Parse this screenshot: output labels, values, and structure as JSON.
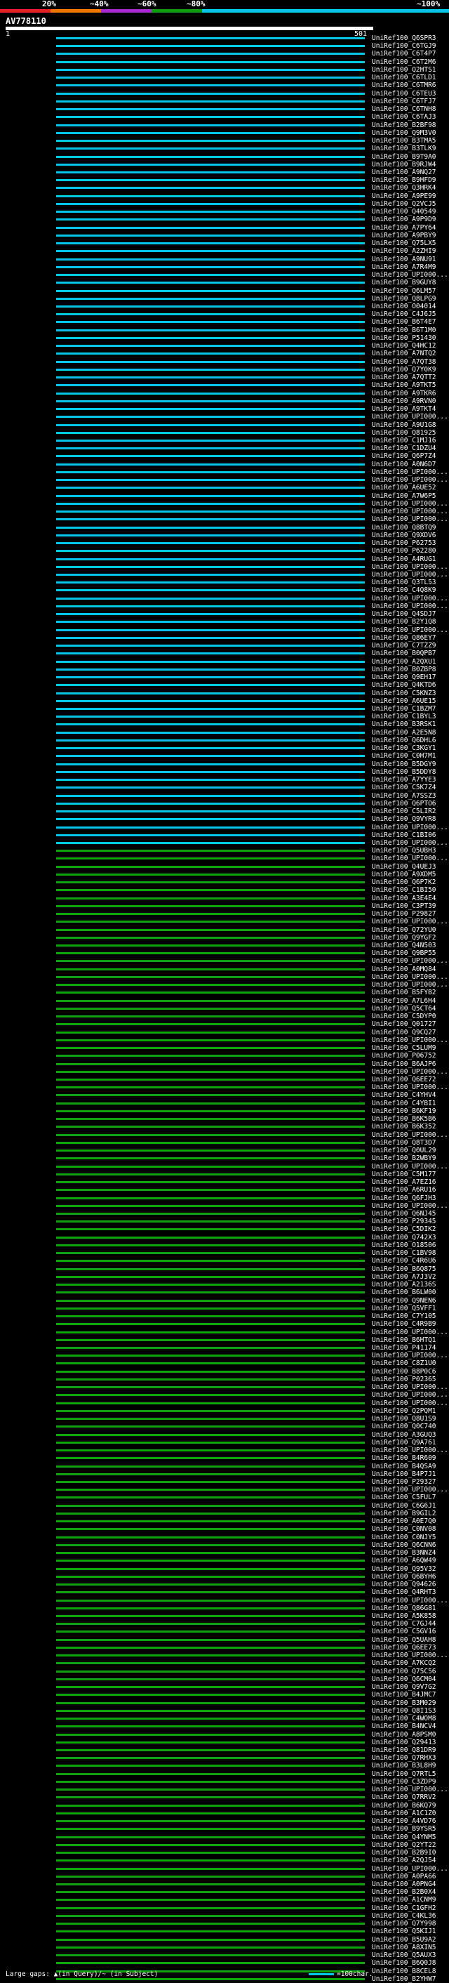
{
  "header": {
    "percent_labels": [
      "20%",
      "~40%",
      "~60%",
      "~80%",
      "~100%"
    ],
    "colors": [
      "#e8202a",
      "#f07800",
      "#a82ad2",
      "#109b10",
      "#00c8e6"
    ]
  },
  "query": {
    "id": "AV778110"
  },
  "ruler": {
    "start": "1",
    "end": "501"
  },
  "hit_colors": {
    "cyan": "#00c8e6",
    "green": "#10a310"
  },
  "hits": [
    {
      "id": "UniRef100_Q6SPR3",
      "color": "cyan"
    },
    {
      "id": "UniRef100_C6TGJ9",
      "color": "cyan"
    },
    {
      "id": "UniRef100_C6T4P7",
      "color": "cyan"
    },
    {
      "id": "UniRef100_C6T2M6",
      "color": "cyan"
    },
    {
      "id": "UniRef100_Q2HTS1",
      "color": "cyan"
    },
    {
      "id": "UniRef100_C6TLD1",
      "color": "cyan"
    },
    {
      "id": "UniRef100_C6TMR6",
      "color": "cyan"
    },
    {
      "id": "UniRef100_C6TEU3",
      "color": "cyan"
    },
    {
      "id": "UniRef100_C6TFJ7",
      "color": "cyan"
    },
    {
      "id": "UniRef100_C6TNH8",
      "color": "cyan"
    },
    {
      "id": "UniRef100_C6TAJ3",
      "color": "cyan"
    },
    {
      "id": "UniRef100_B2BF98",
      "color": "cyan"
    },
    {
      "id": "UniRef100_Q9M3V0",
      "color": "cyan"
    },
    {
      "id": "UniRef100_B3TMA5",
      "color": "cyan"
    },
    {
      "id": "UniRef100_B3TLK9",
      "color": "cyan"
    },
    {
      "id": "UniRef100_B9T9A0",
      "color": "cyan"
    },
    {
      "id": "UniRef100_B9RJW4",
      "color": "cyan"
    },
    {
      "id": "UniRef100_A9NQ27",
      "color": "cyan"
    },
    {
      "id": "UniRef100_B9HFD9",
      "color": "cyan"
    },
    {
      "id": "UniRef100_Q3HRK4",
      "color": "cyan"
    },
    {
      "id": "UniRef100_A9PE99",
      "color": "cyan"
    },
    {
      "id": "UniRef100_Q2VCJ5",
      "color": "cyan"
    },
    {
      "id": "UniRef100_Q40549",
      "color": "cyan"
    },
    {
      "id": "UniRef100_A9P9D9",
      "color": "cyan"
    },
    {
      "id": "UniRef100_A7PY64",
      "color": "cyan"
    },
    {
      "id": "UniRef100_A9PBY9",
      "color": "cyan"
    },
    {
      "id": "UniRef100_Q75LX5",
      "color": "cyan"
    },
    {
      "id": "UniRef100_A2ZHI9",
      "color": "cyan"
    },
    {
      "id": "UniRef100_A9NU91",
      "color": "cyan"
    },
    {
      "id": "UniRef100_A7R4M9",
      "color": "cyan"
    },
    {
      "id": "UniRef100_UPI000...",
      "color": "cyan"
    },
    {
      "id": "UniRef100_B9GUY8",
      "color": "cyan"
    },
    {
      "id": "UniRef100_Q6LM57",
      "color": "cyan"
    },
    {
      "id": "UniRef100_Q8LPG9",
      "color": "cyan"
    },
    {
      "id": "UniRef100_O04014",
      "color": "cyan"
    },
    {
      "id": "UniRef100_C4J6J5",
      "color": "cyan"
    },
    {
      "id": "UniRef100_B6T4E7",
      "color": "cyan"
    },
    {
      "id": "UniRef100_B6T1M0",
      "color": "cyan"
    },
    {
      "id": "UniRef100_P51430",
      "color": "cyan"
    },
    {
      "id": "UniRef100_Q4HC12",
      "color": "cyan"
    },
    {
      "id": "UniRef100_A7NTQ2",
      "color": "cyan"
    },
    {
      "id": "UniRef100_A7QT38",
      "color": "cyan"
    },
    {
      "id": "UniRef100_Q7Y0K9",
      "color": "cyan"
    },
    {
      "id": "UniRef100_A7QTT2",
      "color": "cyan"
    },
    {
      "id": "UniRef100_A9TKT5",
      "color": "cyan"
    },
    {
      "id": "UniRef100_A9TKR6",
      "color": "cyan"
    },
    {
      "id": "UniRef100_A9RVN0",
      "color": "cyan"
    },
    {
      "id": "UniRef100_A9TKT4",
      "color": "cyan"
    },
    {
      "id": "UniRef100_UPI000...",
      "color": "cyan"
    },
    {
      "id": "UniRef100_A9U1G8",
      "color": "cyan"
    },
    {
      "id": "UniRef100_Q81925",
      "color": "cyan"
    },
    {
      "id": "UniRef100_C1MJ16",
      "color": "cyan"
    },
    {
      "id": "UniRef100_C1DZU4",
      "color": "cyan"
    },
    {
      "id": "UniRef100_Q6P7Z4",
      "color": "cyan"
    },
    {
      "id": "UniRef100_A0N6D7",
      "color": "cyan"
    },
    {
      "id": "UniRef100_UPI000...",
      "color": "cyan"
    },
    {
      "id": "UniRef100_UPI000...",
      "color": "cyan"
    },
    {
      "id": "UniRef100_A6UE52",
      "color": "cyan"
    },
    {
      "id": "UniRef100_A7W6P5",
      "color": "cyan"
    },
    {
      "id": "UniRef100_UPI000...",
      "color": "cyan"
    },
    {
      "id": "UniRef100_UPI000...",
      "color": "cyan"
    },
    {
      "id": "UniRef100_UPI000...",
      "color": "cyan"
    },
    {
      "id": "UniRef100_Q8BTQ9",
      "color": "cyan"
    },
    {
      "id": "UniRef100_Q9XDV6",
      "color": "cyan"
    },
    {
      "id": "UniRef100_P62753",
      "color": "cyan"
    },
    {
      "id": "UniRef100_P62280",
      "color": "cyan"
    },
    {
      "id": "UniRef100_A4RUG1",
      "color": "cyan"
    },
    {
      "id": "UniRef100_UPI000...",
      "color": "cyan"
    },
    {
      "id": "UniRef100_UPI000...",
      "color": "cyan"
    },
    {
      "id": "UniRef100_Q3TL53",
      "color": "cyan"
    },
    {
      "id": "UniRef100_C4Q8K9",
      "color": "cyan"
    },
    {
      "id": "UniRef100_UPI000...",
      "color": "cyan"
    },
    {
      "id": "UniRef100_UPI000...",
      "color": "cyan"
    },
    {
      "id": "UniRef100_Q4SDJ7",
      "color": "cyan"
    },
    {
      "id": "UniRef100_B2Y1Q8",
      "color": "cyan"
    },
    {
      "id": "UniRef100_UPI000...",
      "color": "cyan"
    },
    {
      "id": "UniRef100_Q86EY7",
      "color": "cyan"
    },
    {
      "id": "UniRef100_C7TZZ9",
      "color": "cyan"
    },
    {
      "id": "UniRef100_B0QPB7",
      "color": "cyan"
    },
    {
      "id": "UniRef100_A2QXU1",
      "color": "cyan"
    },
    {
      "id": "UniRef100_B0ZBP8",
      "color": "cyan"
    },
    {
      "id": "UniRef100_Q9EH17",
      "color": "cyan"
    },
    {
      "id": "UniRef100_Q4KTD6",
      "color": "cyan"
    },
    {
      "id": "UniRef100_C5KNZ3",
      "color": "cyan"
    },
    {
      "id": "UniRef100_A6UE15",
      "color": "cyan"
    },
    {
      "id": "UniRef100_C1BZM7",
      "color": "cyan"
    },
    {
      "id": "UniRef100_C1BYL3",
      "color": "cyan"
    },
    {
      "id": "UniRef100_B3RSK1",
      "color": "cyan"
    },
    {
      "id": "UniRef100_A2E5N8",
      "color": "cyan"
    },
    {
      "id": "UniRef100_Q6DHL6",
      "color": "cyan"
    },
    {
      "id": "UniRef100_C3KGY1",
      "color": "cyan"
    },
    {
      "id": "UniRef100_C0H7M1",
      "color": "cyan"
    },
    {
      "id": "UniRef100_B5DGY9",
      "color": "cyan"
    },
    {
      "id": "UniRef100_B5DDY8",
      "color": "cyan"
    },
    {
      "id": "UniRef100_A7YYE3",
      "color": "cyan"
    },
    {
      "id": "UniRef100_C5K7Z4",
      "color": "cyan"
    },
    {
      "id": "UniRef100_A7SSZ3",
      "color": "cyan"
    },
    {
      "id": "UniRef100_Q6PTO6",
      "color": "cyan"
    },
    {
      "id": "UniRef100_C5LIR2",
      "color": "cyan"
    },
    {
      "id": "UniRef100_Q9VYR8",
      "color": "cyan"
    },
    {
      "id": "UniRef100_UPI000...",
      "color": "cyan"
    },
    {
      "id": "UniRef100_C1BI06",
      "color": "cyan"
    },
    {
      "id": "UniRef100_UPI000...",
      "color": "cyan"
    },
    {
      "id": "UniRef100_Q5UBH3",
      "color": "green"
    },
    {
      "id": "UniRef100_UPI000...",
      "color": "green"
    },
    {
      "id": "UniRef100_Q4UEJ3",
      "color": "green"
    },
    {
      "id": "UniRef100_A9XDM5",
      "color": "green"
    },
    {
      "id": "UniRef100_Q6P7K2",
      "color": "green"
    },
    {
      "id": "UniRef100_C1BI50",
      "color": "green"
    },
    {
      "id": "UniRef100_A3E4E4",
      "color": "green"
    },
    {
      "id": "UniRef100_C3PT39",
      "color": "green"
    },
    {
      "id": "UniRef100_P29827",
      "color": "green"
    },
    {
      "id": "UniRef100_UPI000...",
      "color": "green"
    },
    {
      "id": "UniRef100_Q72YU0",
      "color": "green"
    },
    {
      "id": "UniRef100_Q9YGF2",
      "color": "green"
    },
    {
      "id": "UniRef100_Q4N503",
      "color": "green"
    },
    {
      "id": "UniRef100_Q9BP55",
      "color": "green"
    },
    {
      "id": "UniRef100_UPI000...",
      "color": "green"
    },
    {
      "id": "UniRef100_A0MQ84",
      "color": "green"
    },
    {
      "id": "UniRef100_UPI000...",
      "color": "green"
    },
    {
      "id": "UniRef100_UPI000...",
      "color": "green"
    },
    {
      "id": "UniRef100_B5FYB2",
      "color": "green"
    },
    {
      "id": "UniRef100_A7L6H4",
      "color": "green"
    },
    {
      "id": "UniRef100_Q5CT64",
      "color": "green"
    },
    {
      "id": "UniRef100_C5DYP0",
      "color": "green"
    },
    {
      "id": "UniRef100_Q01727",
      "color": "green"
    },
    {
      "id": "UniRef100_Q9CQ27",
      "color": "green"
    },
    {
      "id": "UniRef100_UPI000...",
      "color": "green"
    },
    {
      "id": "UniRef100_C5LUM9",
      "color": "green"
    },
    {
      "id": "UniRef100_P06752",
      "color": "green"
    },
    {
      "id": "UniRef100_B6AJP6",
      "color": "green"
    },
    {
      "id": "UniRef100_UPI000...",
      "color": "green"
    },
    {
      "id": "UniRef100_Q6EE72",
      "color": "green"
    },
    {
      "id": "UniRef100_UPI000...",
      "color": "green"
    },
    {
      "id": "UniRef100_C4YHV4",
      "color": "green"
    },
    {
      "id": "UniRef100_C4YBI1",
      "color": "green"
    },
    {
      "id": "UniRef100_B6KF19",
      "color": "green"
    },
    {
      "id": "UniRef100_B6K5B6",
      "color": "green"
    },
    {
      "id": "UniRef100_B6K352",
      "color": "green"
    },
    {
      "id": "UniRef100_UPI000...",
      "color": "green"
    },
    {
      "id": "UniRef100_Q8T3D7",
      "color": "green"
    },
    {
      "id": "UniRef100_Q0UL29",
      "color": "green"
    },
    {
      "id": "UniRef100_B2WBY9",
      "color": "green"
    },
    {
      "id": "UniRef100_UPI000...",
      "color": "green"
    },
    {
      "id": "UniRef100_C5M177",
      "color": "green"
    },
    {
      "id": "UniRef100_A7EZ16",
      "color": "green"
    },
    {
      "id": "UniRef100_A6RU16",
      "color": "green"
    },
    {
      "id": "UniRef100_Q6FJH3",
      "color": "green"
    },
    {
      "id": "UniRef100_UPI000...",
      "color": "green"
    },
    {
      "id": "UniRef100_Q6NJ45",
      "color": "green"
    },
    {
      "id": "UniRef100_P29345",
      "color": "green"
    },
    {
      "id": "UniRef100_C5DIK2",
      "color": "green"
    },
    {
      "id": "UniRef100_Q742X3",
      "color": "green"
    },
    {
      "id": "UniRef100_O18506",
      "color": "green"
    },
    {
      "id": "UniRef100_C1BV98",
      "color": "green"
    },
    {
      "id": "UniRef100_C4R6U6",
      "color": "green"
    },
    {
      "id": "UniRef100_B6Q875",
      "color": "green"
    },
    {
      "id": "UniRef100_A7J3V2",
      "color": "green"
    },
    {
      "id": "UniRef100_A2136S",
      "color": "green"
    },
    {
      "id": "UniRef100_B6LW00",
      "color": "green"
    },
    {
      "id": "UniRef100_Q9NEN6",
      "color": "green"
    },
    {
      "id": "UniRef100_Q5VFF1",
      "color": "green"
    },
    {
      "id": "UniRef100_C7Y105",
      "color": "green"
    },
    {
      "id": "UniRef100_C4R9B9",
      "color": "green"
    },
    {
      "id": "UniRef100_UPI000...",
      "color": "green"
    },
    {
      "id": "UniRef100_B6HTQ1",
      "color": "green"
    },
    {
      "id": "UniRef100_P41174",
      "color": "green"
    },
    {
      "id": "UniRef100_UPI000...",
      "color": "green"
    },
    {
      "id": "UniRef100_C8Z1U0",
      "color": "green"
    },
    {
      "id": "UniRef100_B8P0C6",
      "color": "green"
    },
    {
      "id": "UniRef100_P02365",
      "color": "green"
    },
    {
      "id": "UniRef100_UPI000...",
      "color": "green"
    },
    {
      "id": "UniRef100_UPI000...",
      "color": "green"
    },
    {
      "id": "UniRef100_UPI000...",
      "color": "green"
    },
    {
      "id": "UniRef100_Q2PQM1",
      "color": "green"
    },
    {
      "id": "UniRef100_Q8U1S9",
      "color": "green"
    },
    {
      "id": "UniRef100_Q0C740",
      "color": "green"
    },
    {
      "id": "UniRef100_A3GUQ3",
      "color": "green"
    },
    {
      "id": "UniRef100_Q9A761",
      "color": "green"
    },
    {
      "id": "UniRef100_UPI000...",
      "color": "green"
    },
    {
      "id": "UniRef100_B4R609",
      "color": "green"
    },
    {
      "id": "UniRef100_B4QSA9",
      "color": "green"
    },
    {
      "id": "UniRef100_B4P7J1",
      "color": "green"
    },
    {
      "id": "UniRef100_P29327",
      "color": "green"
    },
    {
      "id": "UniRef100_UPI000...",
      "color": "green"
    },
    {
      "id": "UniRef100_C5FUL7",
      "color": "green"
    },
    {
      "id": "UniRef100_C6G6J1",
      "color": "green"
    },
    {
      "id": "UniRef100_B9GIL2",
      "color": "green"
    },
    {
      "id": "UniRef100_A0E7Q0",
      "color": "green"
    },
    {
      "id": "UniRef100_C0NV08",
      "color": "green"
    },
    {
      "id": "UniRef100_C0NJY5",
      "color": "green"
    },
    {
      "id": "UniRef100_Q6CNN6",
      "color": "green"
    },
    {
      "id": "UniRef100_B3NNZ4",
      "color": "green"
    },
    {
      "id": "UniRef100_A6QW49",
      "color": "green"
    },
    {
      "id": "UniRef100_Q95V32",
      "color": "green"
    },
    {
      "id": "UniRef100_Q6BYH6",
      "color": "green"
    },
    {
      "id": "UniRef100_Q94626",
      "color": "green"
    },
    {
      "id": "UniRef100_Q4RHT3",
      "color": "green"
    },
    {
      "id": "UniRef100_UPI000...",
      "color": "green"
    },
    {
      "id": "UniRef100_Q86G81",
      "color": "green"
    },
    {
      "id": "UniRef100_A5K858",
      "color": "green"
    },
    {
      "id": "UniRef100_C7GJ44",
      "color": "green"
    },
    {
      "id": "UniRef100_C5GV16",
      "color": "green"
    },
    {
      "id": "UniRef100_Q5UAH8",
      "color": "green"
    },
    {
      "id": "UniRef100_Q6EE73",
      "color": "green"
    },
    {
      "id": "UniRef100_UPI000...",
      "color": "green"
    },
    {
      "id": "UniRef100_A7KCQ2",
      "color": "green"
    },
    {
      "id": "UniRef100_Q75C56",
      "color": "green"
    },
    {
      "id": "UniRef100_Q6CM04",
      "color": "green"
    },
    {
      "id": "UniRef100_Q9V7G2",
      "color": "green"
    },
    {
      "id": "UniRef100_B4JMC7",
      "color": "green"
    },
    {
      "id": "UniRef100_B3M029",
      "color": "green"
    },
    {
      "id": "UniRef100_Q8I1S3",
      "color": "green"
    },
    {
      "id": "UniRef100_C4WOM8",
      "color": "green"
    },
    {
      "id": "UniRef100_B4NCV4",
      "color": "green"
    },
    {
      "id": "UniRef100_A8PSM0",
      "color": "green"
    },
    {
      "id": "UniRef100_Q29413",
      "color": "green"
    },
    {
      "id": "UniRef100_Q81DR9",
      "color": "green"
    },
    {
      "id": "UniRef100_Q7RHX3",
      "color": "green"
    },
    {
      "id": "UniRef100_B3L8H9",
      "color": "green"
    },
    {
      "id": "UniRef100_Q7RTL5",
      "color": "green"
    },
    {
      "id": "UniRef100_C3ZDP9",
      "color": "green"
    },
    {
      "id": "UniRef100_UPI000...",
      "color": "green"
    },
    {
      "id": "UniRef100_Q7RRV2",
      "color": "green"
    },
    {
      "id": "UniRef100_B6KQ79",
      "color": "green"
    },
    {
      "id": "UniRef100_A1C1Z0",
      "color": "green"
    },
    {
      "id": "UniRef100_A4VD76",
      "color": "green"
    },
    {
      "id": "UniRef100_B9YSR5",
      "color": "green"
    },
    {
      "id": "UniRef100_Q4YNM5",
      "color": "green"
    },
    {
      "id": "UniRef100_Q2YT22",
      "color": "green"
    },
    {
      "id": "UniRef100_B2B9I0",
      "color": "green"
    },
    {
      "id": "UniRef100_A2QJ54",
      "color": "green"
    },
    {
      "id": "UniRef100_UPI000...",
      "color": "green"
    },
    {
      "id": "UniRef100_A0PA66",
      "color": "green"
    },
    {
      "id": "UniRef100_A0PNG4",
      "color": "green"
    },
    {
      "id": "UniRef100_B2B0X4",
      "color": "green"
    },
    {
      "id": "UniRef100_A1CNM9",
      "color": "green"
    },
    {
      "id": "UniRef100_C1GFH2",
      "color": "green"
    },
    {
      "id": "UniRef100_C4KL36",
      "color": "green"
    },
    {
      "id": "UniRef100_Q7Y998",
      "color": "green"
    },
    {
      "id": "UniRef100_Q5KIJ1",
      "color": "green"
    },
    {
      "id": "UniRef100_B5U9A2",
      "color": "green"
    },
    {
      "id": "UniRef100_A8XIN5",
      "color": "green"
    },
    {
      "id": "UniRef100_Q5AUX3",
      "color": "green"
    },
    {
      "id": "UniRef100_B6Q0J8",
      "color": "green"
    },
    {
      "id": "UniRef100_B8CEL8",
      "color": "green"
    },
    {
      "id": "UniRef100_B2YHW7",
      "color": "green"
    }
  ],
  "legend": {
    "gaps": "Large gaps: ▲(in Query)/~ (in Subject)",
    "scale": "=100char."
  }
}
